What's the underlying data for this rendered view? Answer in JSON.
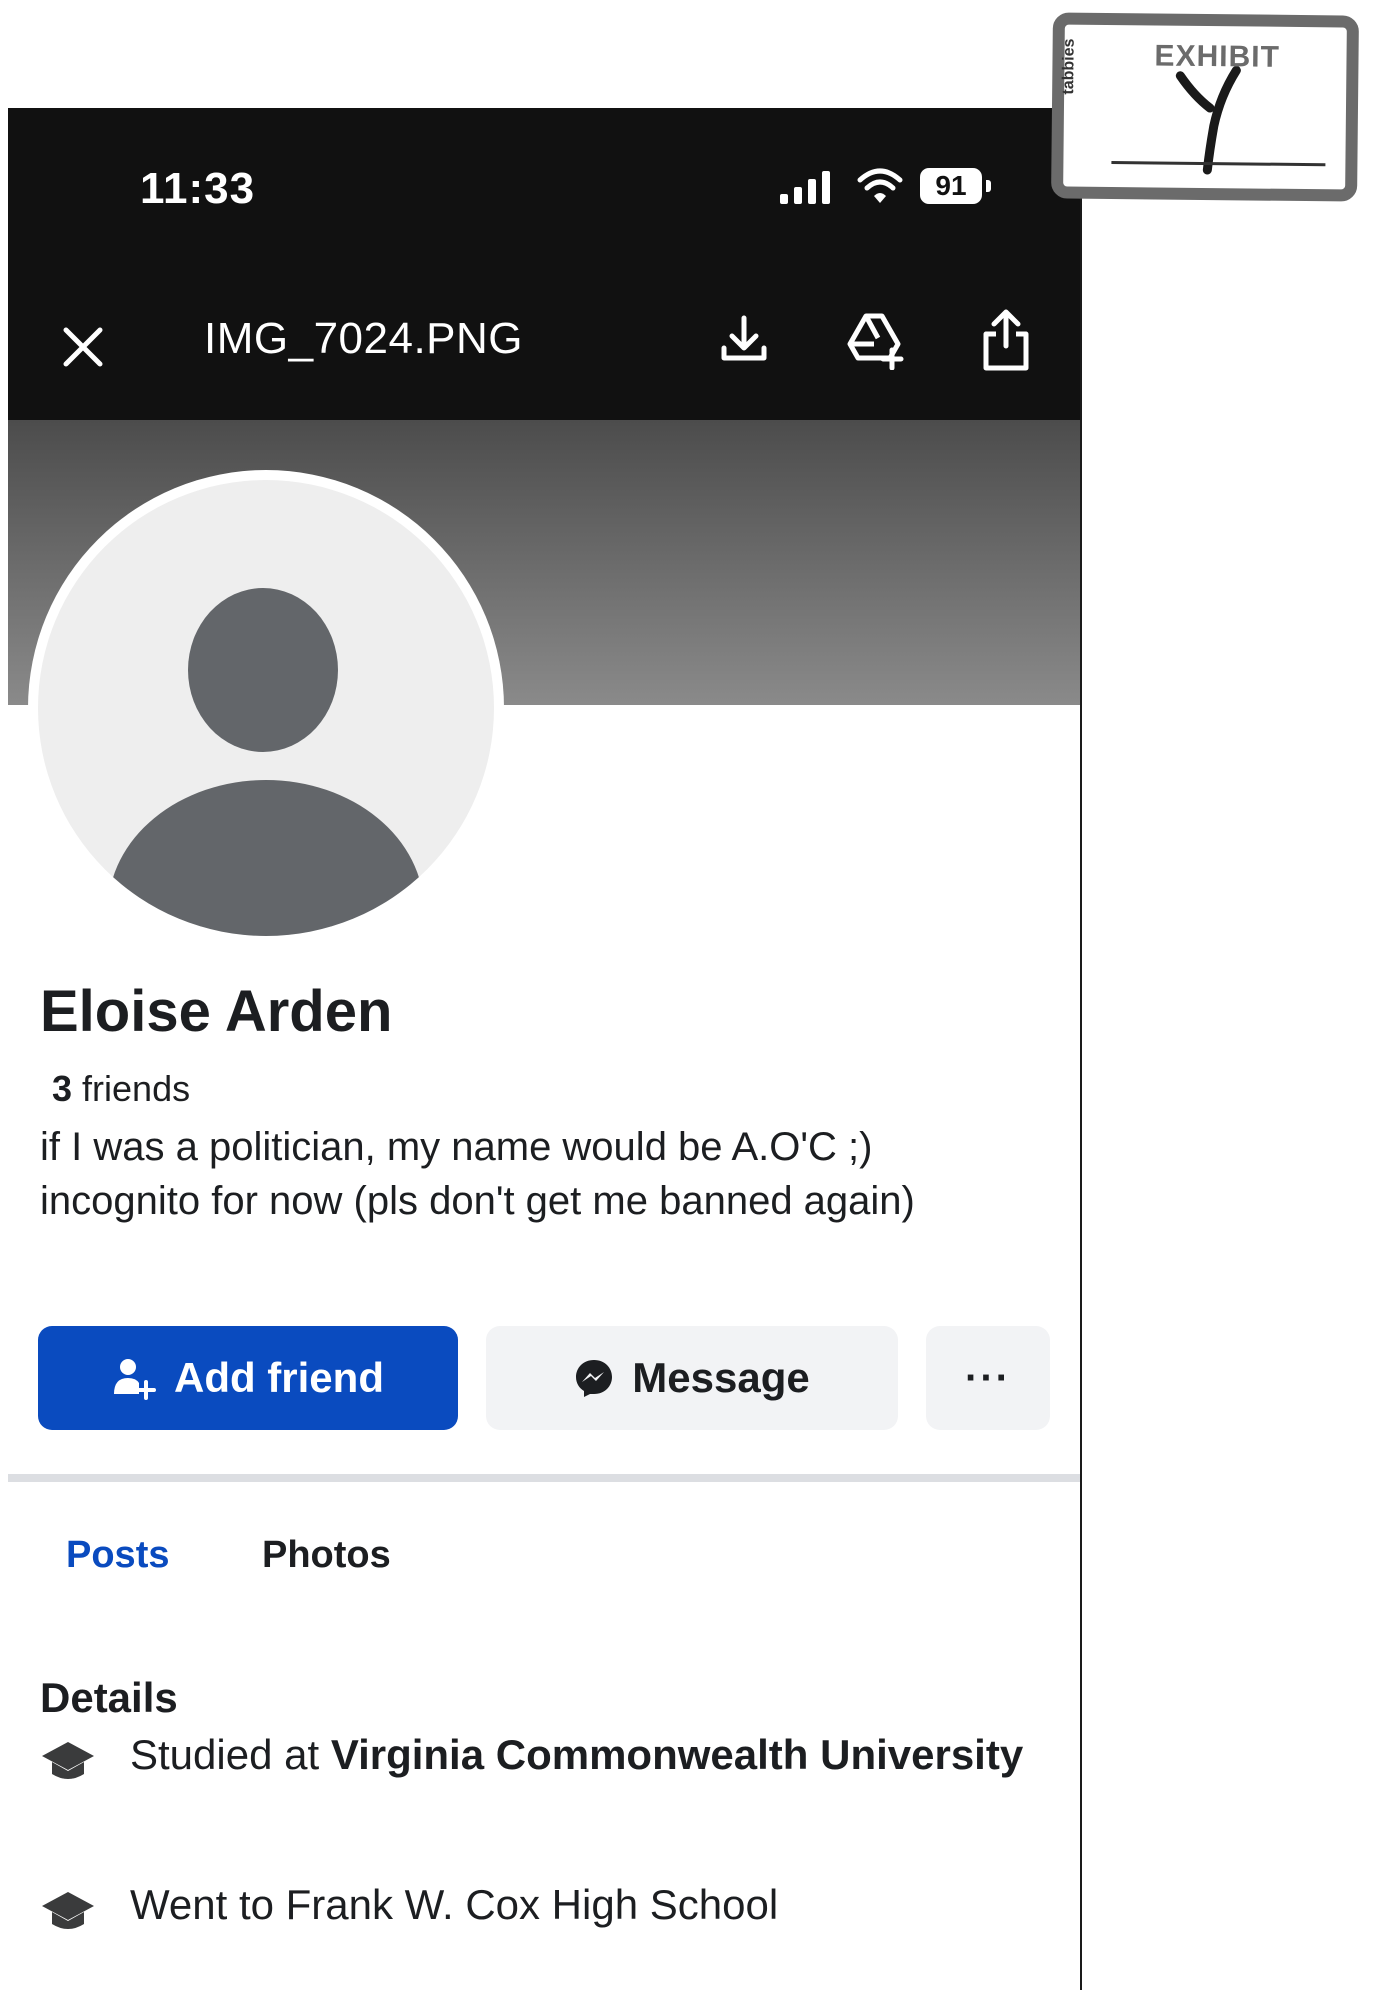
{
  "status_bar": {
    "time": "11:33",
    "battery": "91"
  },
  "viewer": {
    "file_name": "IMG_7024.PNG",
    "icons": [
      "close-icon",
      "download-icon",
      "drive-add-icon",
      "share-icon"
    ]
  },
  "profile": {
    "name": "Eloise Arden",
    "friends_count": "3",
    "friends_label": " friends",
    "bio": "if I was a politician, my name would be A.O'C ;) incognito for now (pls don't get me banned again)"
  },
  "actions": {
    "add_friend": "Add friend",
    "message": "Message",
    "more": "···"
  },
  "tabs": [
    {
      "label": "Posts",
      "active": true
    },
    {
      "label": "Photos",
      "active": false
    }
  ],
  "details": {
    "title": "Details",
    "items": [
      {
        "prefix": "Studied at ",
        "bold": "Virginia Commonwealth University",
        "suffix": "",
        "icon": "graduation-cap-icon"
      },
      {
        "prefix": "Went to Frank W. Cox High School",
        "bold": "",
        "suffix": "",
        "icon": "graduation-cap-icon"
      }
    ]
  },
  "exhibit": {
    "title": "EXHIBIT",
    "brand": "tabbies"
  },
  "colors": {
    "primary_blue": "#0a4bbf",
    "top_bar": "#111111",
    "text": "#1c1e21",
    "button_gray": "#f2f3f5"
  }
}
